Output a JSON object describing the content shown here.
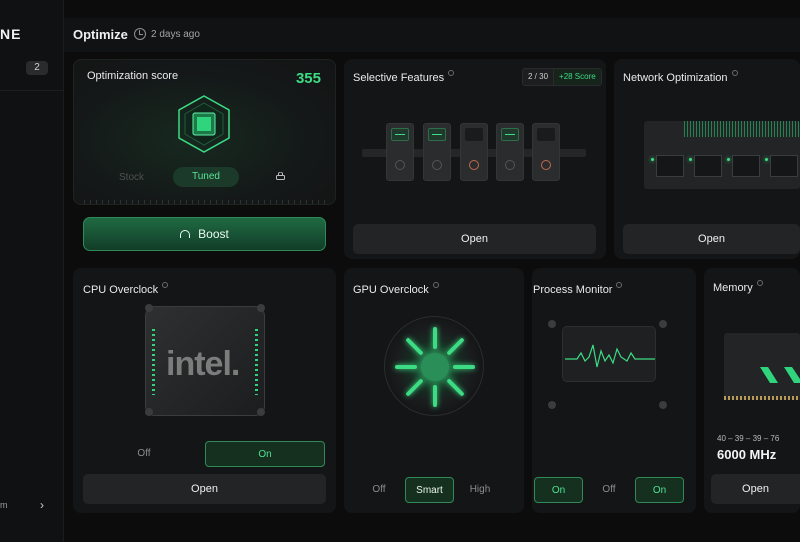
{
  "sidebar": {
    "brand": "NE",
    "badge": "2",
    "footer_text": "m",
    "footer_chevron": "›"
  },
  "header": {
    "title": "Optimize",
    "last_updated": "2 days ago"
  },
  "score_card": {
    "label": "Optimization score",
    "score": "355",
    "modes": [
      "Stock",
      "Tuned"
    ],
    "selected_mode": "Tuned",
    "boost_label": "Boost"
  },
  "selective_features": {
    "title": "Selective Features",
    "count": "2 / 30",
    "score_delta": "+28 Score",
    "open_label": "Open"
  },
  "network": {
    "title": "Network Optimization",
    "open_label": "Open"
  },
  "cpu": {
    "title": "CPU Overclock",
    "logo": "intel.",
    "options": [
      "Off",
      "On"
    ],
    "selected": "On",
    "open_label": "Open"
  },
  "gpu": {
    "title": "GPU Overclock",
    "options": [
      "Off",
      "Smart",
      "High"
    ],
    "selected": "Smart"
  },
  "process": {
    "title": "Process Monitor",
    "options": [
      "On",
      "Off",
      "On"
    ]
  },
  "memory": {
    "title": "Memory",
    "timings": "40 – 39 – 39 – 76",
    "speed": "6000 MHz",
    "open_label": "Open"
  },
  "colors": {
    "accent": "#3ddc84",
    "background": "#0c0c0d",
    "card": "#141516"
  }
}
